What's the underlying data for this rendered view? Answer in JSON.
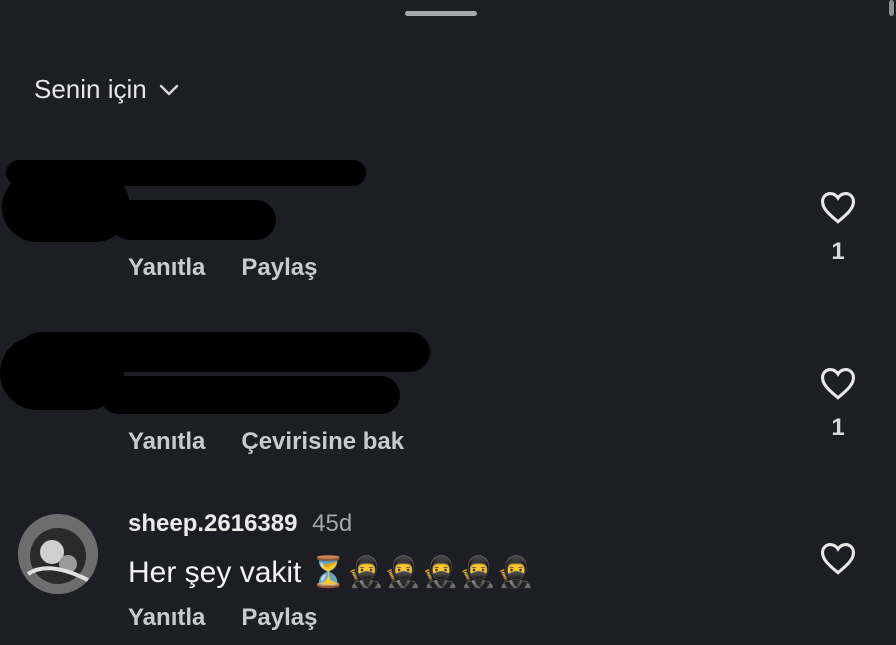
{
  "header": {
    "sort_label": "Senin için"
  },
  "comments": [
    {
      "redacted": true,
      "actions": [
        "Yanıtla",
        "Paylaş"
      ],
      "likes": "1"
    },
    {
      "redacted": true,
      "actions": [
        "Yanıtla",
        "Çevirisine bak"
      ],
      "likes": "1"
    },
    {
      "redacted": false,
      "username": "sheep.2616389",
      "time": "45d",
      "text": "Her şey vakit ⏳🥷🥷🥷🥷🥷",
      "actions": [
        "Yanıtla",
        "Paylaş"
      ],
      "likes": ""
    }
  ],
  "colors": {
    "background": "#1c1e23",
    "secondary_text": "#c9cacd"
  }
}
